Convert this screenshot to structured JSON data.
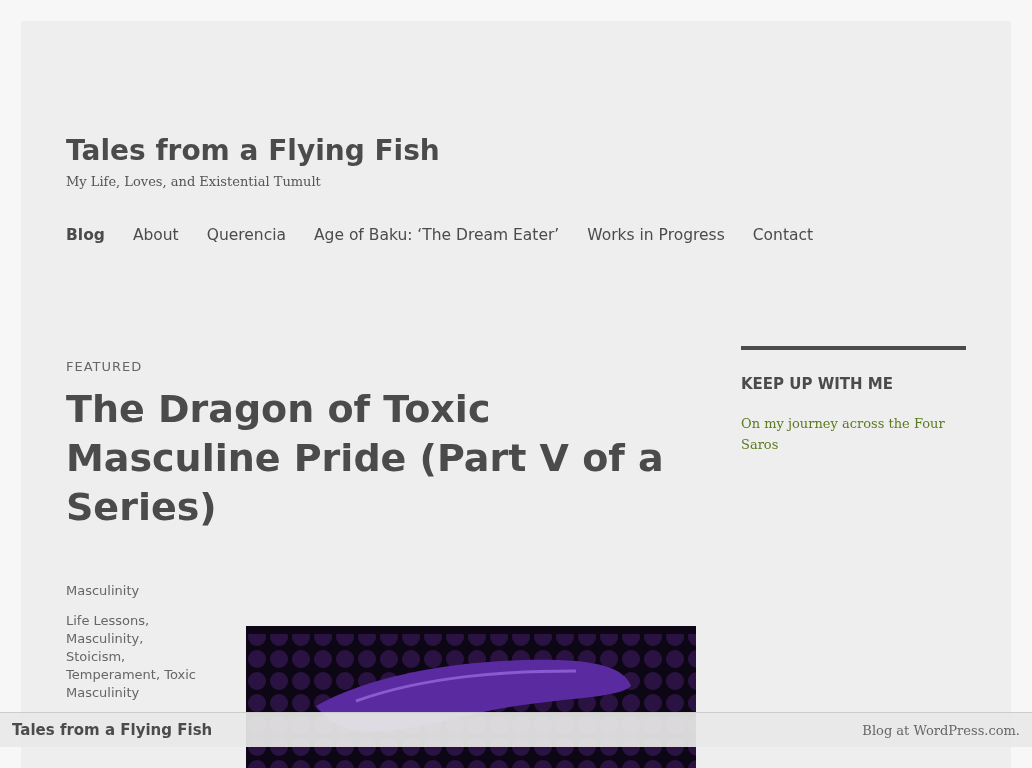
{
  "site": {
    "title": "Tales from a Flying Fish",
    "tagline": "My Life, Loves, and Existential Tumult"
  },
  "nav": [
    {
      "label": "Blog",
      "selected": true
    },
    {
      "label": "About",
      "selected": false
    },
    {
      "label": "Querencia",
      "selected": false
    },
    {
      "label": "Age of Baku: ‘The Dream Eater’",
      "selected": false
    },
    {
      "label": "Works in Progress",
      "selected": false
    },
    {
      "label": "Contact",
      "selected": false
    }
  ],
  "post": {
    "label": "FEATURED",
    "title": "The Dragon of Toxic Masculine Pride (Part V of a Series)",
    "category": "Masculinity",
    "tags": [
      "Life Lessons,",
      "Masculinity,",
      "Stoicism,",
      "Temperament, Toxic",
      "Masculinity"
    ]
  },
  "sidebar": {
    "heading": "KEEP UP WITH ME",
    "link": "On my journey across the Four Saros"
  },
  "footer_bar": {
    "site_name": "Tales from a Flying Fish",
    "credit": "Blog at WordPress.com."
  }
}
